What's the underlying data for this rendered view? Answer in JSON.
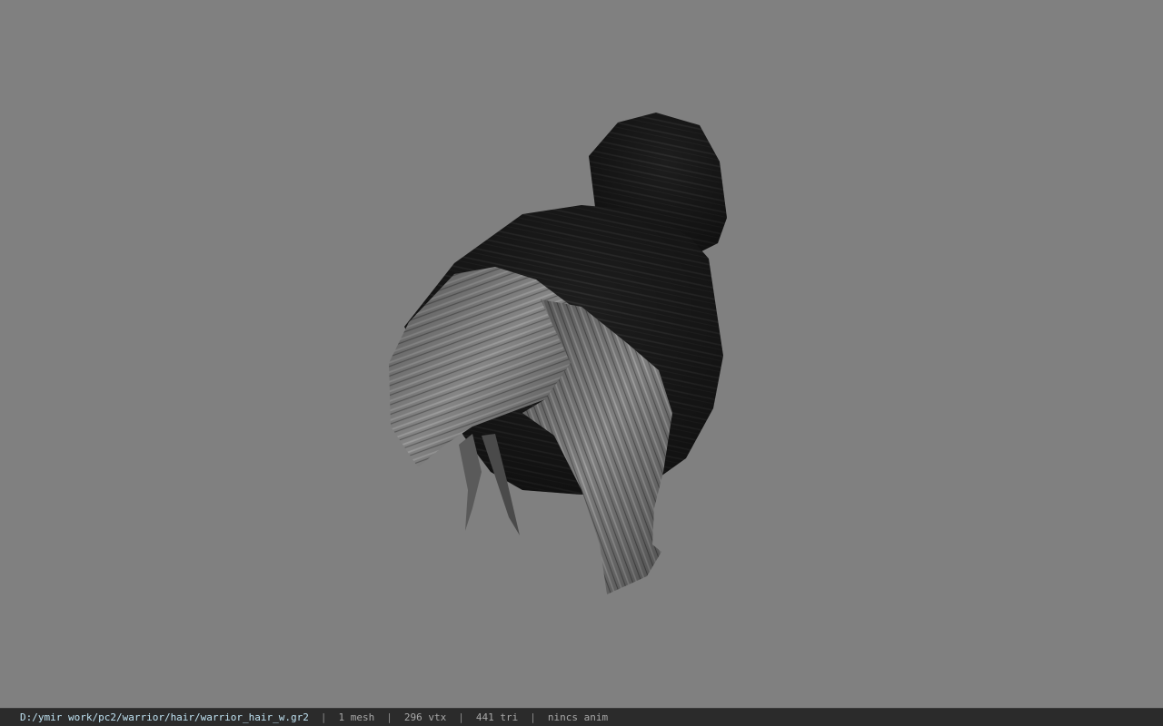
{
  "viewer": {
    "background": "#808080",
    "model_colors": {
      "dark_hair": "#1c1c1c",
      "light_hair": "#8a8a8a"
    }
  },
  "status": {
    "file_path": "D:/ymir work/pc2/warrior/hair/warrior_hair_w.gr2",
    "separator": "|",
    "mesh_count": "1 mesh",
    "vertex_count": "296 vtx",
    "triangle_count": "441 tri",
    "anim_info": "nincs anim"
  }
}
